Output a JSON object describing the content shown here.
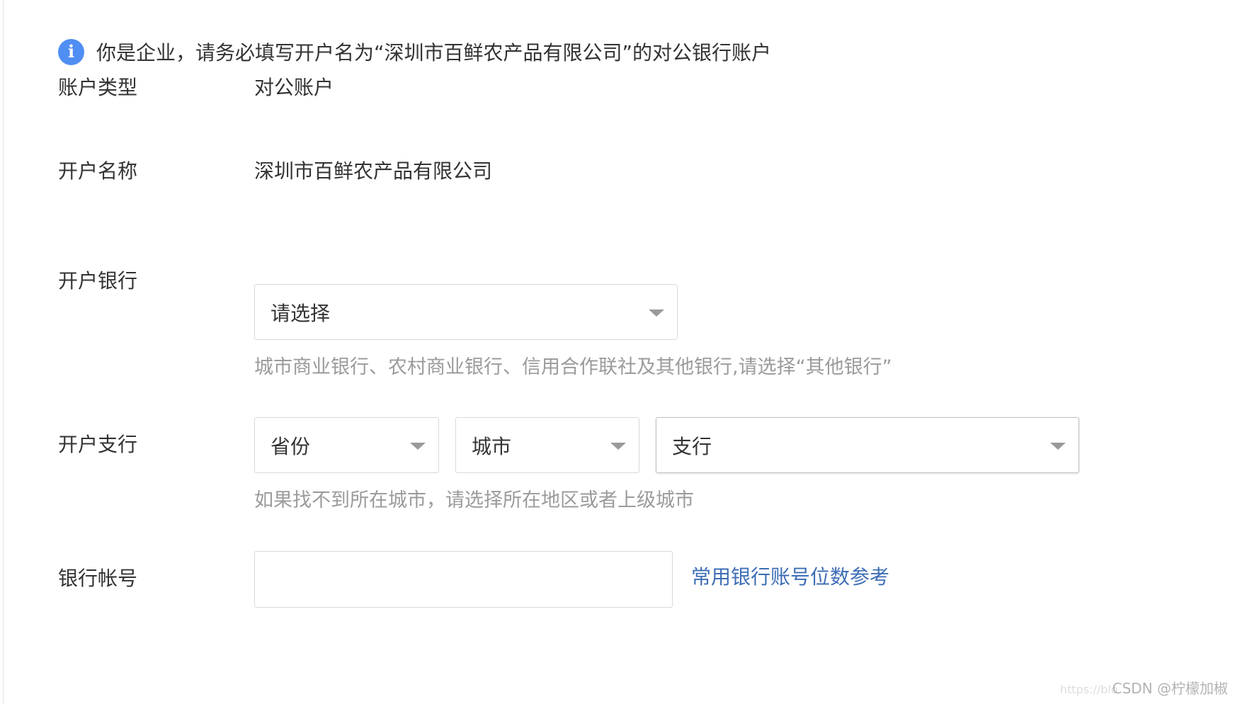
{
  "notice": {
    "icon": "info-icon",
    "icon_glyph": "i",
    "text": "你是企业，请务必填写开户名为“深圳市百鲜农产品有限公司”的对公银行账户"
  },
  "account_type": {
    "label": "账户类型",
    "value": "对公账户"
  },
  "account_name": {
    "label": "开户名称",
    "value": "深圳市百鲜农产品有限公司"
  },
  "bank": {
    "label": "开户银行",
    "select_value": "请选择",
    "hint": "城市商业银行、农村商业银行、信用合作联社及其他银行,请选择“其他银行”"
  },
  "branch": {
    "label": "开户支行",
    "province_value": "省份",
    "city_value": "城市",
    "branch_value": "支行",
    "hint": "如果找不到所在城市，请选择所在地区或者上级城市"
  },
  "account_number": {
    "label": "银行帐号",
    "value": "",
    "reference_link": "常用银行账号位数参考"
  },
  "watermark": {
    "url": "https://blo",
    "author": "CSDN @柠檬加椒"
  },
  "colors": {
    "info_icon": "#4f8ef2",
    "link": "#3d6db5",
    "hint_text": "#9b9b9b",
    "border": "#d9d9d9"
  }
}
